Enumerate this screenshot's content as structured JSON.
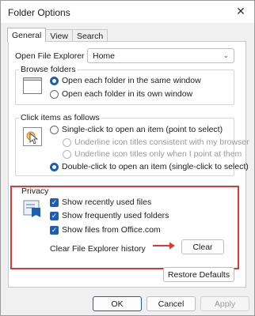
{
  "window": {
    "title": "Folder Options",
    "close_glyph": "✕"
  },
  "tabs": [
    "General",
    "View",
    "Search"
  ],
  "open_explorer": {
    "label": "Open File Explorer to:",
    "value": "Home"
  },
  "browse": {
    "title": "Browse folders",
    "options": [
      "Open each folder in the same window",
      "Open each folder in its own window"
    ]
  },
  "click": {
    "title": "Click items as follows",
    "single": "Single-click to open an item (point to select)",
    "underline_browser": "Underline icon titles consistent with my browser",
    "underline_point": "Underline icon titles only when I point at them",
    "double": "Double-click to open an item (single-click to select)"
  },
  "privacy": {
    "title": "Privacy",
    "checks": [
      "Show recently used files",
      "Show frequently used folders",
      "Show files from Office.com"
    ],
    "history_label": "Clear File Explorer history",
    "clear_button": "Clear"
  },
  "restore_button": "Restore Defaults",
  "footer": {
    "ok": "OK",
    "cancel": "Cancel",
    "apply": "Apply"
  },
  "colors": {
    "accent": "#1a5fb4",
    "highlight": "#e23636"
  }
}
